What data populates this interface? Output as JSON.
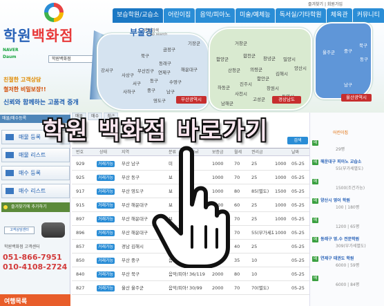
{
  "header": {
    "top_links": "즐겨찾기 | 회원가입",
    "logo": {
      "text_a": "학원",
      "text_b": "백화점"
    },
    "naver_daum": "NAVER Daum",
    "search_text": "학원백화점",
    "taglines": [
      "친절한 고객상담",
      "철저한 비밀보장!!",
      "신뢰와 함께하는 고품격 중개"
    ]
  },
  "nav": {
    "tabs": [
      "보습학원/교습소",
      "어린이집",
      "음악/피아노",
      "미술/예체능",
      "독서실/기타학원",
      "체육관",
      "커뮤니티"
    ]
  },
  "maps": {
    "busan": {
      "title": "부울경",
      "subtitle": "지도검색",
      "subtitle_en": "map search",
      "districts": [
        "기장군",
        "금정구",
        "북구",
        "동래구",
        "해운대구",
        "강서구",
        "사상구",
        "부산진구",
        "연제구",
        "서구",
        "동구",
        "수영구",
        "사하구",
        "중구",
        "남구",
        "영도구"
      ],
      "button": "부산광역시"
    },
    "gyeongnam": {
      "districts": [
        "거창군",
        "합천군",
        "함양군",
        "창녕군",
        "밀양시",
        "산청군",
        "의령군",
        "김해시",
        "양산시",
        "하동군",
        "진주시",
        "함안군",
        "창원시",
        "사천시",
        "고성군",
        "남해군",
        "통영시"
      ],
      "button": "경상남도"
    },
    "ulsan": {
      "districts": [
        "울주군",
        "중구",
        "북구",
        "동구",
        "남구"
      ],
      "button": "울산광역시"
    }
  },
  "left_panel": {
    "header": "매물/매수등록",
    "buttons": [
      "매물 등록",
      "매물 리스트",
      "매수 등록",
      "매수 리스트"
    ],
    "favorite": "즐겨찾기에 추가하기",
    "consult_badge": "고객상담센터",
    "center_label": "학원백화점 고객센터",
    "phone1": "051-866-7951",
    "phone2": "010-4108-2724",
    "bottom_label": "여행목록"
  },
  "overlay": {
    "title": "학원 백화점 바로가기"
  },
  "table": {
    "tabs": [
      "매물",
      "매수",
      "최근"
    ],
    "search_button": "검색",
    "columns": [
      "번호",
      "상태",
      "지역",
      "분류",
      "평/㎡",
      "보증금",
      "월세",
      "권리금",
      "날짜"
    ],
    "rows": [
      {
        "no": "929",
        "status": "거래가능",
        "region": "부산 남구",
        "kind": "미",
        "area": "",
        "deposit": "1000",
        "rent": "70",
        "premium": "25",
        "key": "1000",
        "date": "05-25"
      },
      {
        "no": "925",
        "status": "거래가능",
        "region": "부산 동구",
        "kind": "보",
        "area": "",
        "deposit": "1000",
        "rent": "70",
        "premium": "25",
        "key": "1000",
        "date": "05-25"
      },
      {
        "no": "917",
        "status": "거래가능",
        "region": "부산 영도구",
        "kind": "보",
        "area": "",
        "deposit": "1000",
        "rent": "80",
        "premium": "85(별도)",
        "key": "1500",
        "date": "05-25"
      },
      {
        "no": "915",
        "status": "거래가능",
        "region": "부산 해운대구",
        "kind": "보",
        "area": "",
        "deposit": "1000",
        "rent": "60",
        "premium": "25",
        "key": "1000",
        "date": "05-25"
      },
      {
        "no": "897",
        "status": "거래가능",
        "region": "부산 해운대구",
        "kind": "보",
        "area": "",
        "deposit": "1000",
        "rent": "70",
        "premium": "25",
        "key": "1000",
        "date": "05-25"
      },
      {
        "no": "896",
        "status": "거래가능",
        "region": "부산 해운대구",
        "kind": "미",
        "area": "",
        "deposit": "1000",
        "rent": "70",
        "premium": "55(부가세포함)",
        "key": "1000",
        "date": "05-25"
      },
      {
        "no": "857",
        "status": "거래가능",
        "region": "경남 김해시",
        "kind": "음악/피아노",
        "area": "",
        "deposit": "500",
        "rent": "40",
        "premium": "25",
        "key": "",
        "date": "05-25"
      },
      {
        "no": "850",
        "status": "거래가능",
        "region": "부산 중구",
        "kind": "음악/피아노",
        "area": "20/66",
        "deposit": "1000",
        "rent": "35",
        "premium": "10",
        "key": "",
        "date": "05-25"
      },
      {
        "no": "840",
        "status": "거래가능",
        "region": "부산 북구",
        "kind": "음악/피아노",
        "area": "36/119",
        "deposit": "2000",
        "rent": "80",
        "premium": "10",
        "key": "",
        "date": "05-25"
      },
      {
        "no": "827",
        "status": "거래가능",
        "region": "울산 울주군",
        "kind": "음악/피아노",
        "area": "30/99",
        "deposit": "2000",
        "rent": "70",
        "premium": "70(별도)",
        "key": "",
        "date": "05-25"
      }
    ]
  },
  "right_panel": {
    "header": "어린이집",
    "items": [
      {
        "tag": "매",
        "title": "",
        "line": "29평"
      },
      {
        "tag": "매",
        "title": "해운대구 피아노 교습소",
        "line": "55(부가세별도)"
      },
      {
        "tag": "매",
        "title": "",
        "line": "1500(조건가능)"
      },
      {
        "tag": "매",
        "title": "양산시 영어 학원",
        "line": "100 | 180평"
      },
      {
        "tag": "매",
        "title": "",
        "line": "1200 | 65평"
      },
      {
        "tag": "매",
        "title": "동래구 영.수 전문학원",
        "line": "309(부가세별도)"
      },
      {
        "tag": "매",
        "title": "연제구 태권도 학원",
        "line": "6000 | 59평"
      },
      {
        "tag": "매",
        "title": "",
        "line": "6000 | 84평"
      }
    ]
  }
}
